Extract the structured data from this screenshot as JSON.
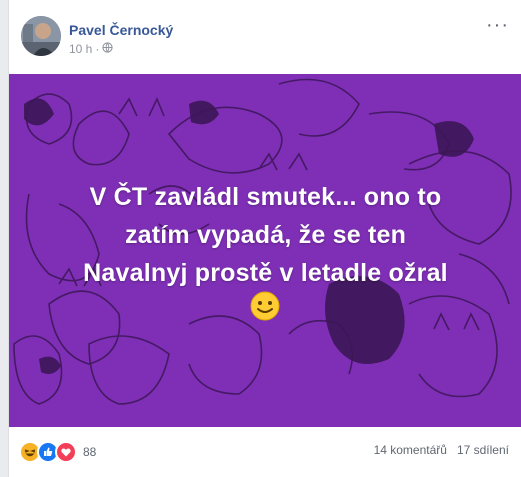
{
  "post": {
    "author": "Pavel Černocký",
    "time": "10 h",
    "separator": "·",
    "audience_icon": "globe-icon",
    "more_label": "···",
    "text_lines": [
      "V ČT zavládl smutek... ono to",
      "zatím vypadá, že se ten",
      "Navalnyj prostě v letadle ožral"
    ],
    "emoji": "slightly-smiling-face-icon",
    "background_color": "#7e2fb5"
  },
  "footer": {
    "reactions": [
      "haha-icon",
      "like-icon",
      "love-icon"
    ],
    "reaction_count": "88",
    "comments": "14 komentářů",
    "shares": "17 sdílení"
  },
  "colors": {
    "accent": "#385898",
    "text_muted": "#90949c",
    "like": "#1877f2",
    "love": "#f33e58",
    "haha": "#f7b125"
  }
}
